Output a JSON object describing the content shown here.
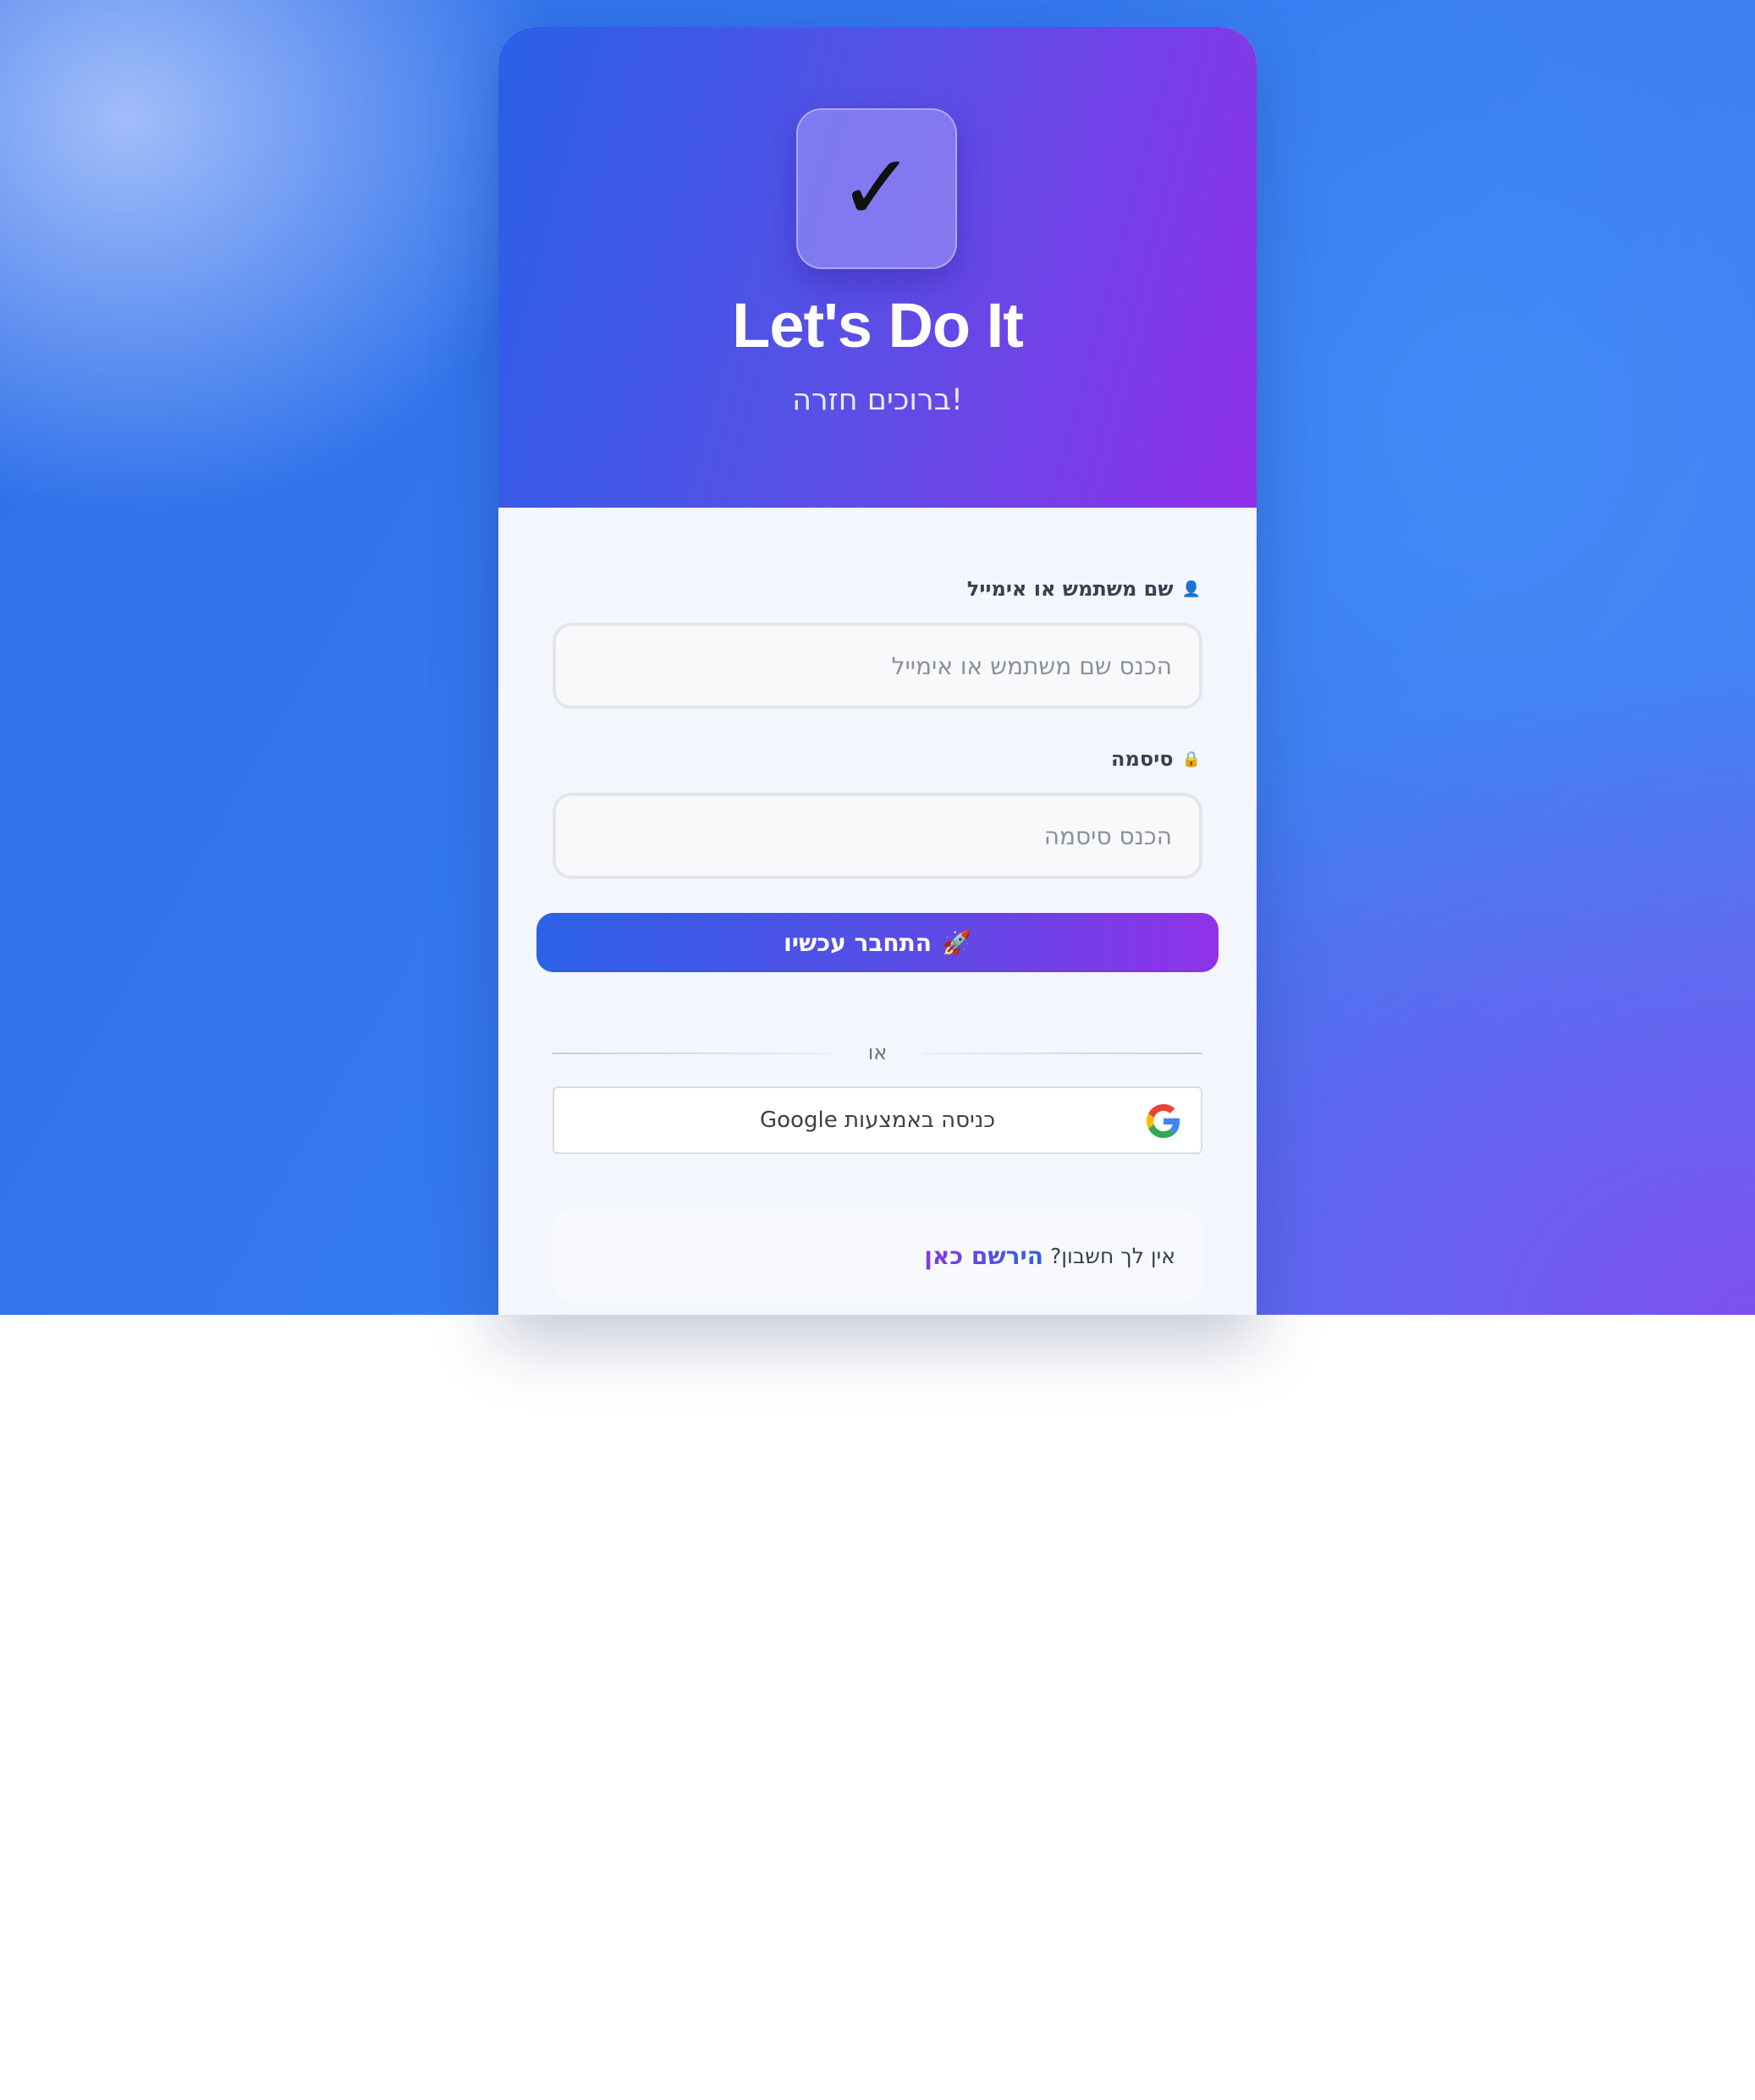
{
  "app": {
    "logo_glyph": "✓",
    "title": "Let's Do It",
    "subtitle": "ברוכים חזרה!"
  },
  "form": {
    "username": {
      "label": "שם משתמש או אימייל",
      "label_icon": "👤",
      "icon_name": "user-icon",
      "placeholder": "הכנס שם משתמש או אימייל",
      "value": ""
    },
    "password": {
      "label": "סיסמה",
      "label_icon": "🔒",
      "icon_name": "lock-icon",
      "placeholder": "הכנס סיסמה",
      "value": ""
    },
    "submit": {
      "label": "התחבר עכשיו",
      "icon": "🚀",
      "icon_name": "rocket-icon"
    }
  },
  "divider": {
    "text": "או"
  },
  "google": {
    "label": "כניסה באמצעות Google",
    "icon_name": "google-g-icon"
  },
  "register": {
    "prompt": "אין לך חשבון?",
    "link_label": "הירשם כאן"
  },
  "colors": {
    "brand_blue": "#2a60e8",
    "brand_purple": "#9030e8",
    "background_blue": "#3579f0"
  }
}
